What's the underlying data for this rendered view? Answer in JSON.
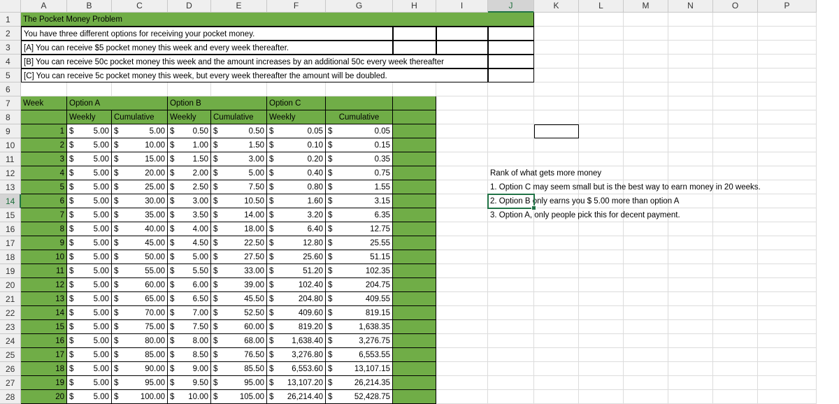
{
  "columns": [
    "A",
    "B",
    "C",
    "D",
    "E",
    "F",
    "G",
    "H",
    "I",
    "J",
    "K",
    "L",
    "M",
    "N",
    "O",
    "P"
  ],
  "selected_column": "J",
  "selected_row": 14,
  "title": "The Pocket Money Problem",
  "intro": "You have three different options for receiving your pocket money.",
  "option_a_desc": "[A] You can receive $5 pocket money this week and every week thereafter.",
  "option_b_desc": "[B] You can receive 50c pocket money this week and the amount increases by an additional 50c every week thereafter",
  "option_c_desc": "[C] You can receive 5c pocket money this week, but every week thereafter the amount will be doubled.",
  "headers": {
    "week": "Week",
    "option_a": "Option A",
    "option_b": "Option B",
    "option_c": "Option C",
    "weekly": "Weekly",
    "cumulative": "Cumulative"
  },
  "currency_symbol": "$",
  "rows": [
    {
      "week": "1",
      "a_w": "5.00",
      "a_c": "5.00",
      "b_w": "0.50",
      "b_c": "0.50",
      "c_w": "0.05",
      "c_c": "0.05"
    },
    {
      "week": "2",
      "a_w": "5.00",
      "a_c": "10.00",
      "b_w": "1.00",
      "b_c": "1.50",
      "c_w": "0.10",
      "c_c": "0.15"
    },
    {
      "week": "3",
      "a_w": "5.00",
      "a_c": "15.00",
      "b_w": "1.50",
      "b_c": "3.00",
      "c_w": "0.20",
      "c_c": "0.35"
    },
    {
      "week": "4",
      "a_w": "5.00",
      "a_c": "20.00",
      "b_w": "2.00",
      "b_c": "5.00",
      "c_w": "0.40",
      "c_c": "0.75"
    },
    {
      "week": "5",
      "a_w": "5.00",
      "a_c": "25.00",
      "b_w": "2.50",
      "b_c": "7.50",
      "c_w": "0.80",
      "c_c": "1.55"
    },
    {
      "week": "6",
      "a_w": "5.00",
      "a_c": "30.00",
      "b_w": "3.00",
      "b_c": "10.50",
      "c_w": "1.60",
      "c_c": "3.15"
    },
    {
      "week": "7",
      "a_w": "5.00",
      "a_c": "35.00",
      "b_w": "3.50",
      "b_c": "14.00",
      "c_w": "3.20",
      "c_c": "6.35"
    },
    {
      "week": "8",
      "a_w": "5.00",
      "a_c": "40.00",
      "b_w": "4.00",
      "b_c": "18.00",
      "c_w": "6.40",
      "c_c": "12.75"
    },
    {
      "week": "9",
      "a_w": "5.00",
      "a_c": "45.00",
      "b_w": "4.50",
      "b_c": "22.50",
      "c_w": "12.80",
      "c_c": "25.55"
    },
    {
      "week": "10",
      "a_w": "5.00",
      "a_c": "50.00",
      "b_w": "5.00",
      "b_c": "27.50",
      "c_w": "25.60",
      "c_c": "51.15"
    },
    {
      "week": "11",
      "a_w": "5.00",
      "a_c": "55.00",
      "b_w": "5.50",
      "b_c": "33.00",
      "c_w": "51.20",
      "c_c": "102.35"
    },
    {
      "week": "12",
      "a_w": "5.00",
      "a_c": "60.00",
      "b_w": "6.00",
      "b_c": "39.00",
      "c_w": "102.40",
      "c_c": "204.75"
    },
    {
      "week": "13",
      "a_w": "5.00",
      "a_c": "65.00",
      "b_w": "6.50",
      "b_c": "45.50",
      "c_w": "204.80",
      "c_c": "409.55"
    },
    {
      "week": "14",
      "a_w": "5.00",
      "a_c": "70.00",
      "b_w": "7.00",
      "b_c": "52.50",
      "c_w": "409.60",
      "c_c": "819.15"
    },
    {
      "week": "15",
      "a_w": "5.00",
      "a_c": "75.00",
      "b_w": "7.50",
      "b_c": "60.00",
      "c_w": "819.20",
      "c_c": "1,638.35"
    },
    {
      "week": "16",
      "a_w": "5.00",
      "a_c": "80.00",
      "b_w": "8.00",
      "b_c": "68.00",
      "c_w": "1,638.40",
      "c_c": "3,276.75"
    },
    {
      "week": "17",
      "a_w": "5.00",
      "a_c": "85.00",
      "b_w": "8.50",
      "b_c": "76.50",
      "c_w": "3,276.80",
      "c_c": "6,553.55"
    },
    {
      "week": "18",
      "a_w": "5.00",
      "a_c": "90.00",
      "b_w": "9.00",
      "b_c": "85.50",
      "c_w": "6,553.60",
      "c_c": "13,107.15"
    },
    {
      "week": "19",
      "a_w": "5.00",
      "a_c": "95.00",
      "b_w": "9.50",
      "b_c": "95.00",
      "c_w": "13,107.20",
      "c_c": "26,214.35"
    },
    {
      "week": "20",
      "a_w": "5.00",
      "a_c": "100.00",
      "b_w": "10.00",
      "b_c": "105.00",
      "c_w": "26,214.40",
      "c_c": "52,428.75"
    }
  ],
  "notes": [
    "Rank of what gets more money",
    "1. Option C may seem small but is the best way to earn money in 20 weeks.",
    "2. Option B only earns you $ 5.00 more than option A",
    "3. Option A, only people pick this for decent payment."
  ]
}
